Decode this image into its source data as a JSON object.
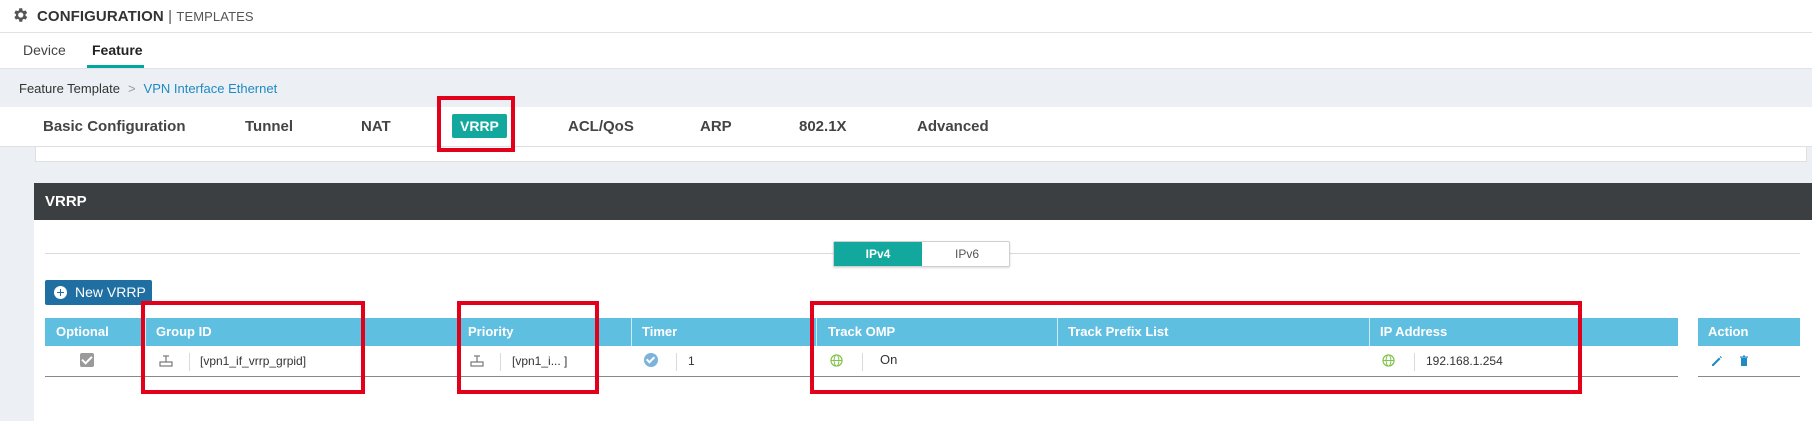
{
  "header": {
    "title": "CONFIGURATION",
    "separator": "|",
    "subtitle": "TEMPLATES",
    "icon": "gear-icon"
  },
  "subnav": {
    "tabs": [
      {
        "label": "Device",
        "active": false
      },
      {
        "label": "Feature",
        "active": true
      }
    ]
  },
  "breadcrumb": {
    "root": "Feature Template",
    "arrow": ">",
    "current": "VPN Interface Ethernet"
  },
  "tabs": [
    {
      "label": "Basic Configuration"
    },
    {
      "label": "Tunnel"
    },
    {
      "label": "NAT"
    },
    {
      "label": "VRRP",
      "active": true
    },
    {
      "label": "ACL/QoS"
    },
    {
      "label": "ARP"
    },
    {
      "label": "802.1X"
    },
    {
      "label": "Advanced"
    }
  ],
  "panel": {
    "title": "VRRP",
    "ip_toggle": {
      "options": [
        "IPv4",
        "IPv6"
      ],
      "selected": "IPv4"
    },
    "new_button": "New VRRP"
  },
  "table": {
    "columns": [
      "Optional",
      "Group ID",
      "Priority",
      "Timer",
      "Track OMP",
      "Track Prefix List",
      "IP Address",
      "Action"
    ],
    "row": {
      "optional_checked": true,
      "group_id": "[vpn1_if_vrrp_grpid]",
      "priority": "[vpn1_i... ]",
      "timer": "1",
      "track_omp": "On",
      "track_prefix_list": "",
      "ip_address": "192.168.1.254"
    }
  },
  "colors": {
    "accent": "#12a89d",
    "table_header": "#5fbfe0",
    "panel_header": "#3c3f42",
    "button": "#1f6fa3",
    "highlight_box": "#e3001b"
  }
}
